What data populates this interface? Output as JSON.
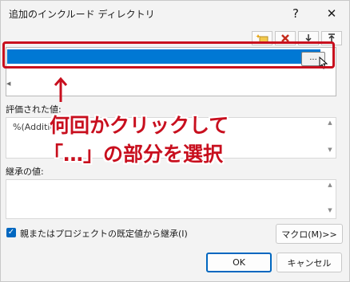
{
  "dialog": {
    "title": "追加のインクルード ディレクトリ",
    "help_label": "?",
    "close_label": "✕"
  },
  "toolbar": {
    "new_line_icon": "new-line-icon",
    "delete_icon": "delete-icon",
    "move_down_icon": "move-down-icon",
    "move_up_icon": "move-up-icon"
  },
  "list": {
    "ellipsis_label": "...",
    "selected_color": "#0078d4"
  },
  "evaluated": {
    "label": "評価された値:",
    "value": "%(Additio"
  },
  "inherited": {
    "label": "継承の値:"
  },
  "inherit_checkbox": {
    "label": "親またはプロジェクトの既定値から継承(I)",
    "checked": true
  },
  "buttons": {
    "macro": "マクロ(M)>>",
    "ok": "OK",
    "cancel": "キャンセル"
  },
  "annotation": {
    "line1": "何回かクリックして",
    "line2": "「…」の部分を選択",
    "color": "#c80f1e"
  }
}
